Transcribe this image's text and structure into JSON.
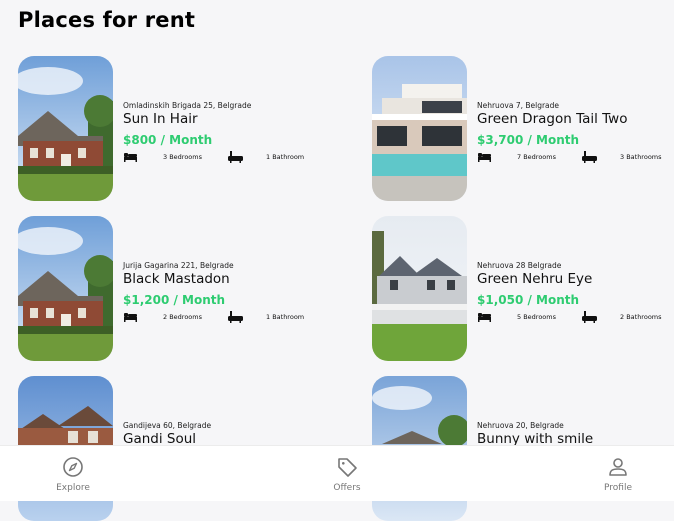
{
  "page": {
    "title": "Places for rent"
  },
  "listings": [
    {
      "address": "Omladinskih Brigada 25, Belgrade",
      "name": "Sun In Hair",
      "price": "$800 / Month",
      "bedrooms": "3 Bedrooms",
      "bathrooms": "1 Bathroom",
      "photo": "brick-house-photo"
    },
    {
      "address": "Nehruova 7, Belgrade",
      "name": "Green Dragon Tail Two",
      "price": "$3,700 / Month",
      "bedrooms": "7 Bedrooms",
      "bathrooms": "3 Bathrooms",
      "photo": "modern-villa-pool-photo"
    },
    {
      "address": "Jurija Gagarina 221, Belgrade",
      "name": "Black Mastadon",
      "price": "$1,200 / Month",
      "bedrooms": "2 Bedrooms",
      "bathrooms": "1 Bathroom",
      "photo": "brick-house-photo"
    },
    {
      "address": "Nehruova 28 Belgrade",
      "name": "Green Nehru Eye",
      "price": "$1,050 / Month",
      "bedrooms": "5 Bedrooms",
      "bathrooms": "2 Bathrooms",
      "photo": "white-porch-house-photo"
    },
    {
      "address": "Gandijeva 60, Belgrade",
      "name": "Gandi Soul",
      "photo": "brick-mansion-photo"
    },
    {
      "address": "Nehruova 20, Belgrade",
      "name": "Bunny with smile",
      "photo": "house-trees-photo"
    }
  ],
  "nav": {
    "items": [
      {
        "label": "Explore",
        "icon": "compass-icon"
      },
      {
        "label": "Offers",
        "icon": "tag-icon"
      },
      {
        "label": "Profile",
        "icon": "person-icon"
      }
    ]
  },
  "colors": {
    "price": "#2ecc71",
    "background": "#f6f6f8",
    "nav_label": "#777777"
  }
}
